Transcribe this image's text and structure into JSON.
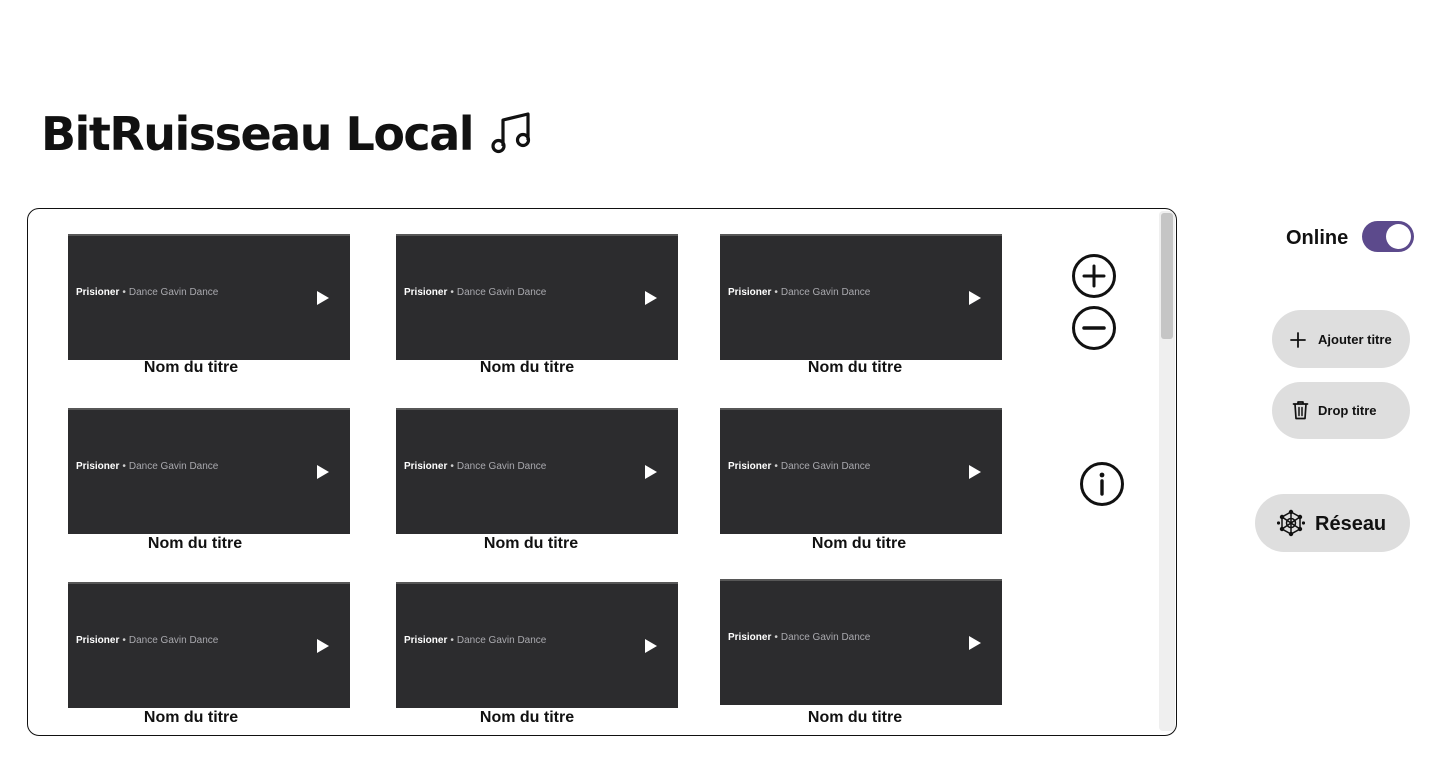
{
  "app": {
    "title": "BitRuisseau Local",
    "title_icon": "music-note-icon"
  },
  "playlist": {
    "tracks": [
      {
        "song": "Prisioner",
        "separator": "•",
        "artist": "Dance Gavin Dance",
        "title": "Nom du titre"
      },
      {
        "song": "Prisioner",
        "separator": "•",
        "artist": "Dance Gavin Dance",
        "title": "Nom du titre"
      },
      {
        "song": "Prisioner",
        "separator": "•",
        "artist": "Dance Gavin Dance",
        "title": "Nom du titre"
      },
      {
        "song": "Prisioner",
        "separator": "•",
        "artist": "Dance Gavin Dance",
        "title": "Nom du titre"
      },
      {
        "song": "Prisioner",
        "separator": "•",
        "artist": "Dance Gavin Dance",
        "title": "Nom du titre"
      },
      {
        "song": "Prisioner",
        "separator": "•",
        "artist": "Dance Gavin Dance",
        "title": "Nom du titre"
      },
      {
        "song": "Prisioner",
        "separator": "•",
        "artist": "Dance Gavin Dance",
        "title": "Nom du titre"
      },
      {
        "song": "Prisioner",
        "separator": "•",
        "artist": "Dance Gavin Dance",
        "title": "Nom du titre"
      },
      {
        "song": "Prisioner",
        "separator": "•",
        "artist": "Dance Gavin Dance",
        "title": "Nom du titre"
      }
    ],
    "controls": {
      "zoom_in_icon": "plus-circle-icon",
      "zoom_out_icon": "minus-circle-icon",
      "info_icon": "info-circle-icon"
    }
  },
  "sidebar": {
    "online": {
      "label": "Online",
      "enabled": true,
      "toggle_color": "#5c4a8c"
    },
    "add_button": {
      "label": "Ajouter titre",
      "icon": "plus-icon"
    },
    "drop_button": {
      "label": "Drop titre",
      "icon": "trash-icon"
    },
    "network_button": {
      "label": "Réseau",
      "icon": "network-icon"
    }
  },
  "colors": {
    "card_background": "#2c2c2e",
    "pill_background": "#dedede",
    "text": "#111111"
  }
}
